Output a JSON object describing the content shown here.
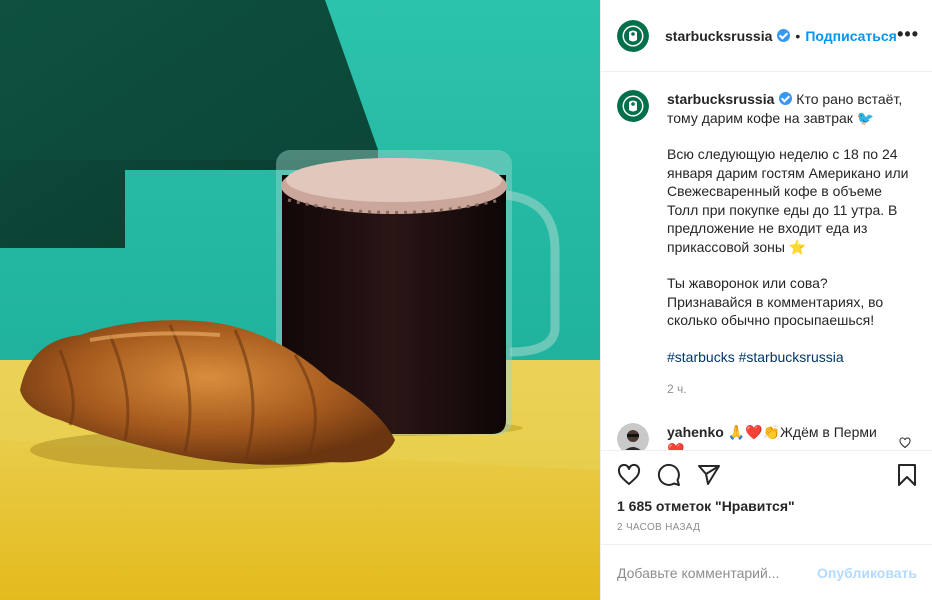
{
  "post": {
    "username": "starbucksrussia",
    "follow_label": "Подписаться",
    "more_label": "•••",
    "caption": {
      "line1_text": "Кто рано встаёт, тому дарим кофе на завтрак 🐦",
      "para2": "Всю следующую неделю с 18 по 24 января дарим гостям Американо или Свежесваренный кофе в объеме Толл при покупке еды до 11 утра. В предложение не входит еда из прикассовой зоны ⭐",
      "para3": "Ты жаворонок или сова? Признавайся в комментариях, во сколько обычно просыпаешься!",
      "hashtags": [
        "#starbucks",
        "#starbucksrussia"
      ],
      "time": "2 ч."
    },
    "comment": {
      "username": "yahenko",
      "text": "🙏❤️👏Ждём в Перми ❤️"
    },
    "likes": "1 685 отметок \"Нравится\"",
    "ago": "2 ЧАСОВ НАЗАД",
    "add_comment_placeholder": "Добавьте комментарий...",
    "publish_label": "Опубликовать"
  },
  "icons": {
    "like": "heart-icon",
    "comment": "comment-icon",
    "share": "share-icon",
    "save": "bookmark-icon",
    "more": "more-icon",
    "verified": "verified-badge-icon"
  },
  "colors": {
    "accent": "#0095f6",
    "verified": "#3897f0",
    "publish_disabled": "#b3dbff",
    "bg_teal": "#1fb3a0",
    "bg_dark_green": "#0c4a3a",
    "bg_yellow": "#e0c22a"
  }
}
